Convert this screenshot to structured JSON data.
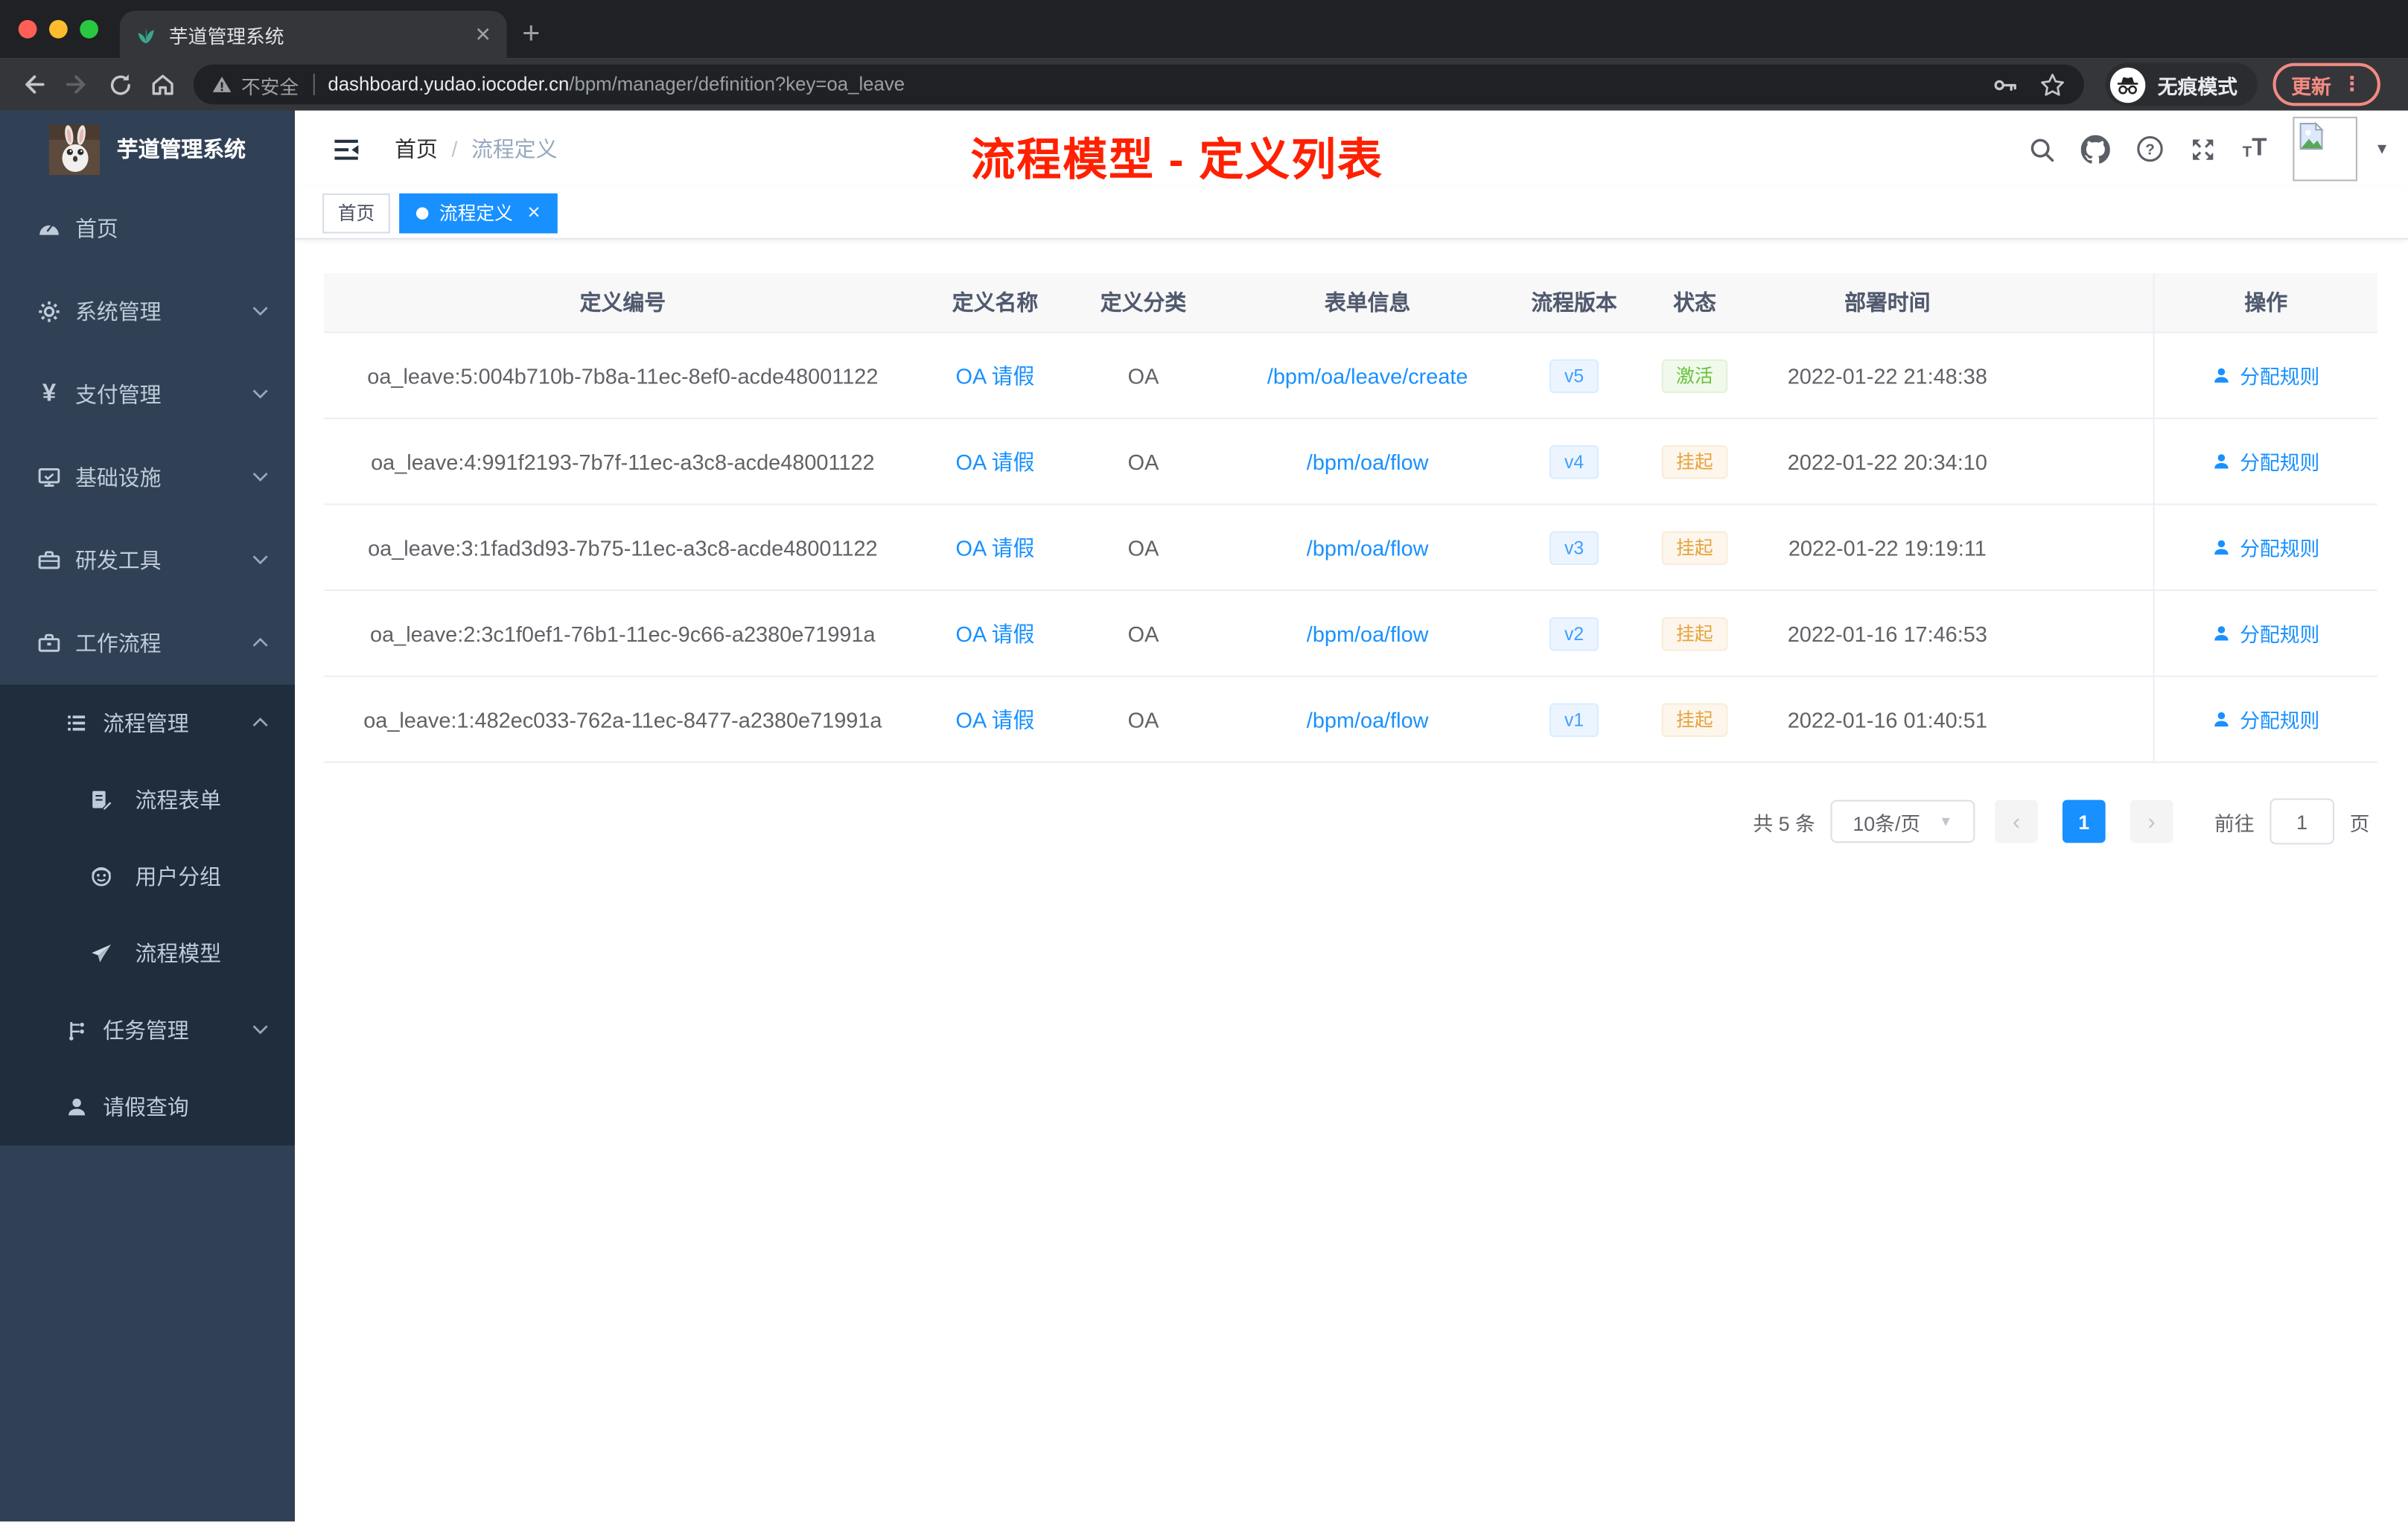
{
  "browser": {
    "tab_title": "芋道管理系统",
    "new_tab": "+",
    "security_label": "不安全",
    "url_host": "dashboard.yudao.iocoder.cn",
    "url_path": "/bpm/manager/definition?key=oa_leave",
    "incognito_label": "无痕模式",
    "update_label": "更新"
  },
  "sidebar": {
    "app_title": "芋道管理系统",
    "items": [
      {
        "label": "首页"
      },
      {
        "label": "系统管理"
      },
      {
        "label": "支付管理"
      },
      {
        "label": "基础设施"
      },
      {
        "label": "研发工具"
      },
      {
        "label": "工作流程"
      }
    ],
    "submenu": [
      {
        "label": "流程管理"
      },
      {
        "label": "流程表单"
      },
      {
        "label": "用户分组"
      },
      {
        "label": "流程模型"
      },
      {
        "label": "任务管理"
      },
      {
        "label": "请假查询"
      }
    ]
  },
  "header": {
    "breadcrumb_home": "首页",
    "breadcrumb_sep": "/",
    "breadcrumb_current": "流程定义",
    "annotation": "流程模型 - 定义列表",
    "annotation_color": "#ff2000"
  },
  "tags": [
    {
      "label": "首页"
    },
    {
      "label": "流程定义"
    }
  ],
  "table": {
    "columns": [
      "定义编号",
      "定义名称",
      "定义分类",
      "表单信息",
      "流程版本",
      "状态",
      "部署时间",
      "操作"
    ],
    "action_label": "分配规则",
    "rows": [
      {
        "id": "oa_leave:5:004b710b-7b8a-11ec-8ef0-acde48001122",
        "name": "OA 请假",
        "category": "OA",
        "form": "/bpm/oa/leave/create",
        "version": "v5",
        "status": "激活",
        "status_type": "success",
        "time": "2022-01-22 21:48:38"
      },
      {
        "id": "oa_leave:4:991f2193-7b7f-11ec-a3c8-acde48001122",
        "name": "OA 请假",
        "category": "OA",
        "form": "/bpm/oa/flow",
        "version": "v4",
        "status": "挂起",
        "status_type": "warning",
        "time": "2022-01-22 20:34:10"
      },
      {
        "id": "oa_leave:3:1fad3d93-7b75-11ec-a3c8-acde48001122",
        "name": "OA 请假",
        "category": "OA",
        "form": "/bpm/oa/flow",
        "version": "v3",
        "status": "挂起",
        "status_type": "warning",
        "time": "2022-01-22 19:19:11"
      },
      {
        "id": "oa_leave:2:3c1f0ef1-76b1-11ec-9c66-a2380e71991a",
        "name": "OA 请假",
        "category": "OA",
        "form": "/bpm/oa/flow",
        "version": "v2",
        "status": "挂起",
        "status_type": "warning",
        "time": "2022-01-16 17:46:53"
      },
      {
        "id": "oa_leave:1:482ec033-762a-11ec-8477-a2380e71991a",
        "name": "OA 请假",
        "category": "OA",
        "form": "/bpm/oa/flow",
        "version": "v1",
        "status": "挂起",
        "status_type": "warning",
        "time": "2022-01-16 01:40:51"
      }
    ]
  },
  "pagination": {
    "total": "共 5 条",
    "page_size": "10条/页",
    "current_page": "1",
    "goto_label": "前往",
    "goto_value": "1",
    "unit_label": "页"
  },
  "colors": {
    "accent": "#1890ff",
    "sidebar_bg": "#304156",
    "submenu_bg": "#1f2d3d",
    "status_active": "#67c23a",
    "status_suspended": "#e6a23c"
  }
}
